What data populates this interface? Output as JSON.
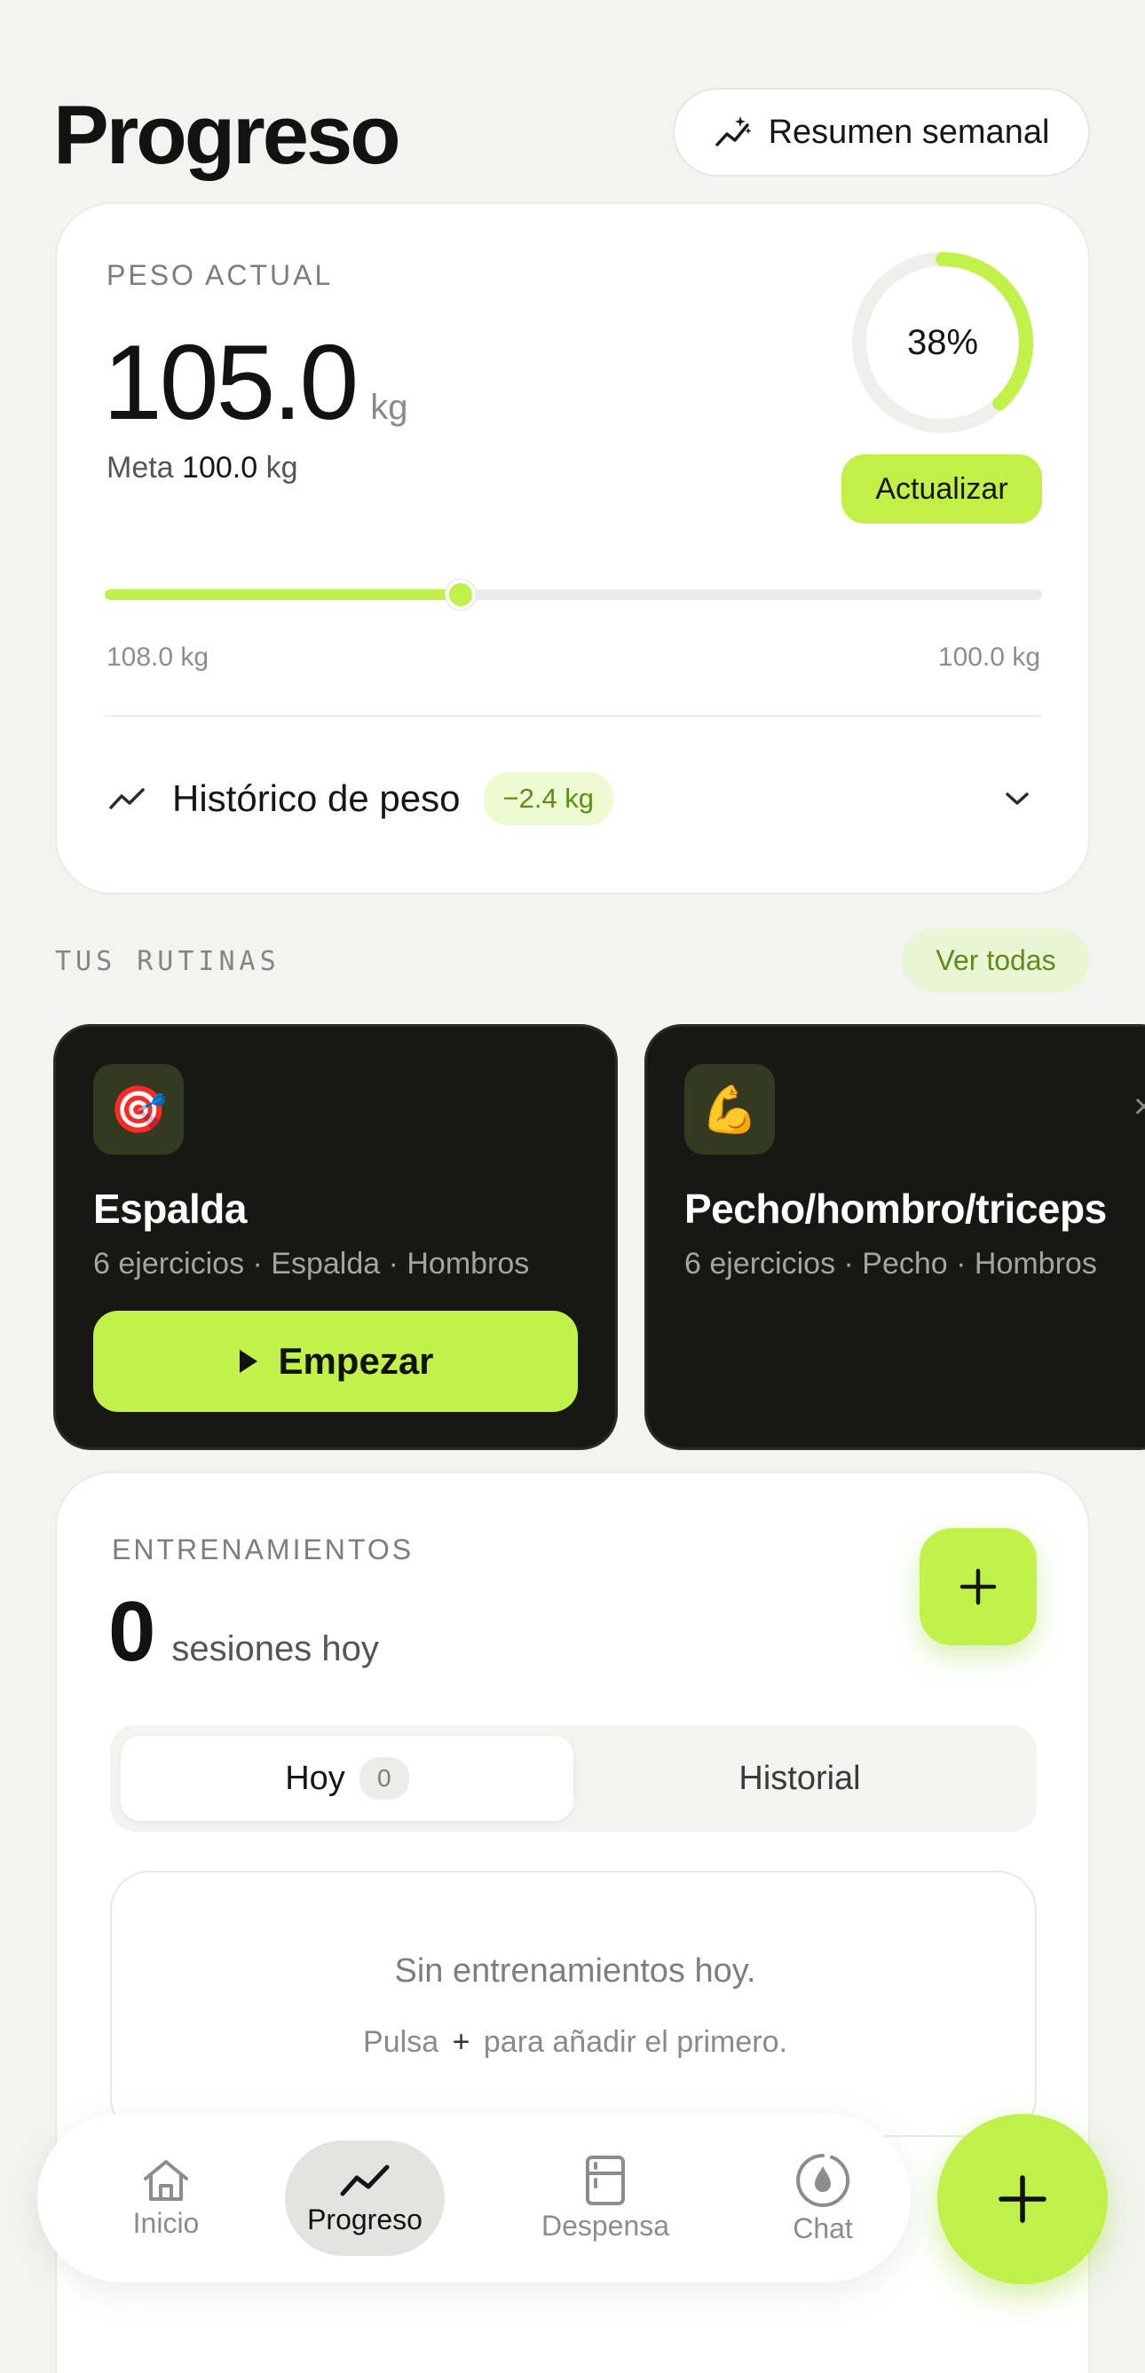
{
  "header": {
    "title": "Progreso",
    "summary_label": "Resumen semanal"
  },
  "weight": {
    "label": "PESO ACTUAL",
    "current": "105.0",
    "unit": "kg",
    "goal_prefix": "Meta",
    "goal_value": "100.0",
    "goal_unit": "kg",
    "progress_label": "38%",
    "progress_fraction": 0.38,
    "update_label": "Actualizar",
    "range_start": "108.0 kg",
    "range_end": "100.0 kg",
    "history_title": "Histórico de peso",
    "history_delta": "−2.4 kg"
  },
  "routines": {
    "section_title": "TUS RUTINAS",
    "see_all_label": "Ver todas",
    "items": [
      {
        "icon": "🎯",
        "name": "Espalda",
        "subtitle": "6 ejercicios · Espalda · Hombros",
        "start_label": "Empezar"
      },
      {
        "icon": "💪",
        "name": "Pecho/hombro/triceps",
        "subtitle": "6 ejercicios · Pecho · Hombros",
        "close_glyph": "×"
      }
    ]
  },
  "workouts": {
    "label": "ENTRENAMIENTOS",
    "count": "0",
    "count_suffix": "sesiones hoy",
    "tab_today": "Hoy",
    "tab_today_count": "0",
    "tab_history": "Historial",
    "empty_title": "Sin entrenamientos hoy.",
    "empty_sub_prefix": "Pulsa",
    "empty_sub_glyph": "+",
    "empty_sub_suffix": "para añadir el primero."
  },
  "nav": {
    "items": [
      {
        "label": "Inicio",
        "icon": "home-icon"
      },
      {
        "label": "Progreso",
        "icon": "trend-icon"
      },
      {
        "label": "Despensa",
        "icon": "fridge-icon"
      },
      {
        "label": "Chat",
        "icon": "chat-icon"
      }
    ],
    "active_index": 1
  },
  "colors": {
    "accent": "#c1f24a",
    "background": "#f3f3f1",
    "routine_card": "#171814"
  }
}
